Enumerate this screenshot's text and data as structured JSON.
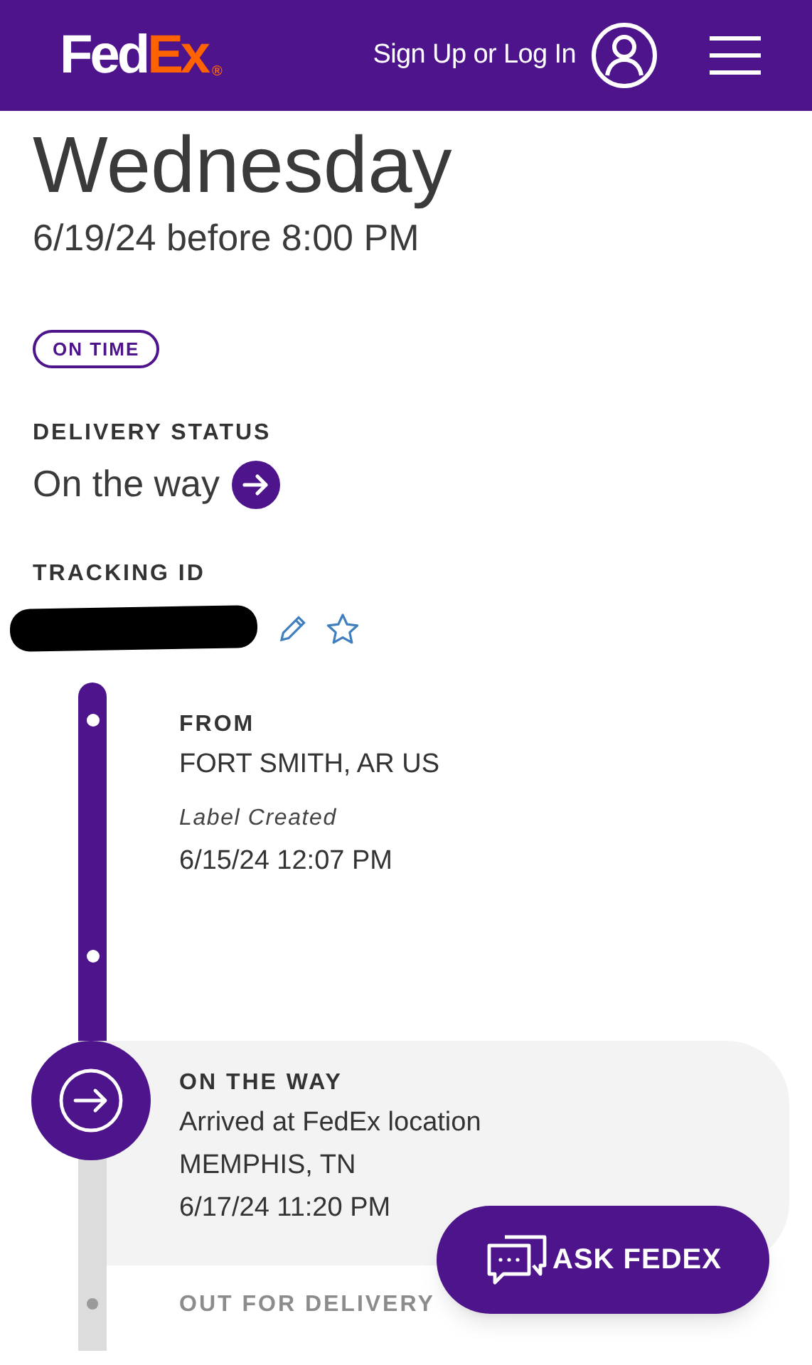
{
  "header": {
    "logo": {
      "fed": "Fed",
      "ex": "Ex",
      "mark": "®"
    },
    "sign_in": "Sign Up or Log In"
  },
  "delivery": {
    "day": "Wednesday",
    "date": "6/19/24 before 8:00 PM",
    "badge": "ON TIME"
  },
  "status": {
    "label": "DELIVERY STATUS",
    "value": "On the way"
  },
  "tracking": {
    "label": "TRACKING ID",
    "redacted": true
  },
  "timeline": [
    {
      "kind": "done",
      "title": "FROM",
      "lines": [
        "FORT SMITH, AR US"
      ],
      "note": "Label Created",
      "time": "6/15/24 12:07 PM"
    },
    {
      "kind": "current",
      "title": "ON THE WAY",
      "lines": [
        "Arrived at FedEx location",
        "MEMPHIS, TN",
        "6/17/24 11:20 PM"
      ]
    },
    {
      "kind": "upcoming",
      "title": "OUT FOR DELIVERY"
    }
  ],
  "chat_button": "ASK FEDEX"
}
